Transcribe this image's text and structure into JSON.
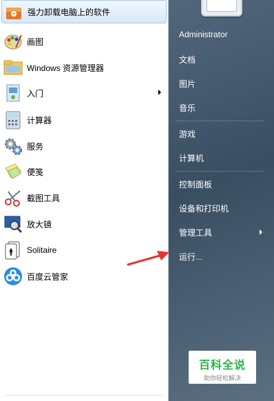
{
  "programs": [
    {
      "label": "强力卸载电脑上的软件",
      "icon": "uninstall-box-icon",
      "highlighted": true
    },
    {
      "label": "画图",
      "icon": "paint-palette-icon"
    },
    {
      "label": "Windows 资源管理器",
      "icon": "folder-explorer-icon"
    },
    {
      "label": "入门",
      "icon": "getting-started-icon",
      "has_submenu": true
    },
    {
      "label": "计算器",
      "icon": "calculator-icon"
    },
    {
      "label": "服务",
      "icon": "gears-icon"
    },
    {
      "label": "便笺",
      "icon": "sticky-note-icon"
    },
    {
      "label": "截图工具",
      "icon": "scissors-icon"
    },
    {
      "label": "放大镜",
      "icon": "magnifier-icon"
    },
    {
      "label": "Solitaire",
      "icon": "cards-icon"
    },
    {
      "label": "百度云管家",
      "icon": "baidu-cloud-icon"
    }
  ],
  "right_menu": [
    {
      "label": "Administrator"
    },
    {
      "label": "文档"
    },
    {
      "label": "图片"
    },
    {
      "label": "音乐"
    },
    {
      "label": "游戏"
    },
    {
      "label": "计算机"
    },
    {
      "label": "控制面板"
    },
    {
      "label": "设备和打印机"
    },
    {
      "label": "管理工具",
      "has_submenu": true
    },
    {
      "label": "运行..."
    }
  ],
  "watermark": {
    "title": "百科全说",
    "subtitle": "助你轻松解决"
  },
  "colors": {
    "annotation_arrow": "#e8322f",
    "right_pane": "#3d5166",
    "watermark_green": "#2eb14a"
  }
}
